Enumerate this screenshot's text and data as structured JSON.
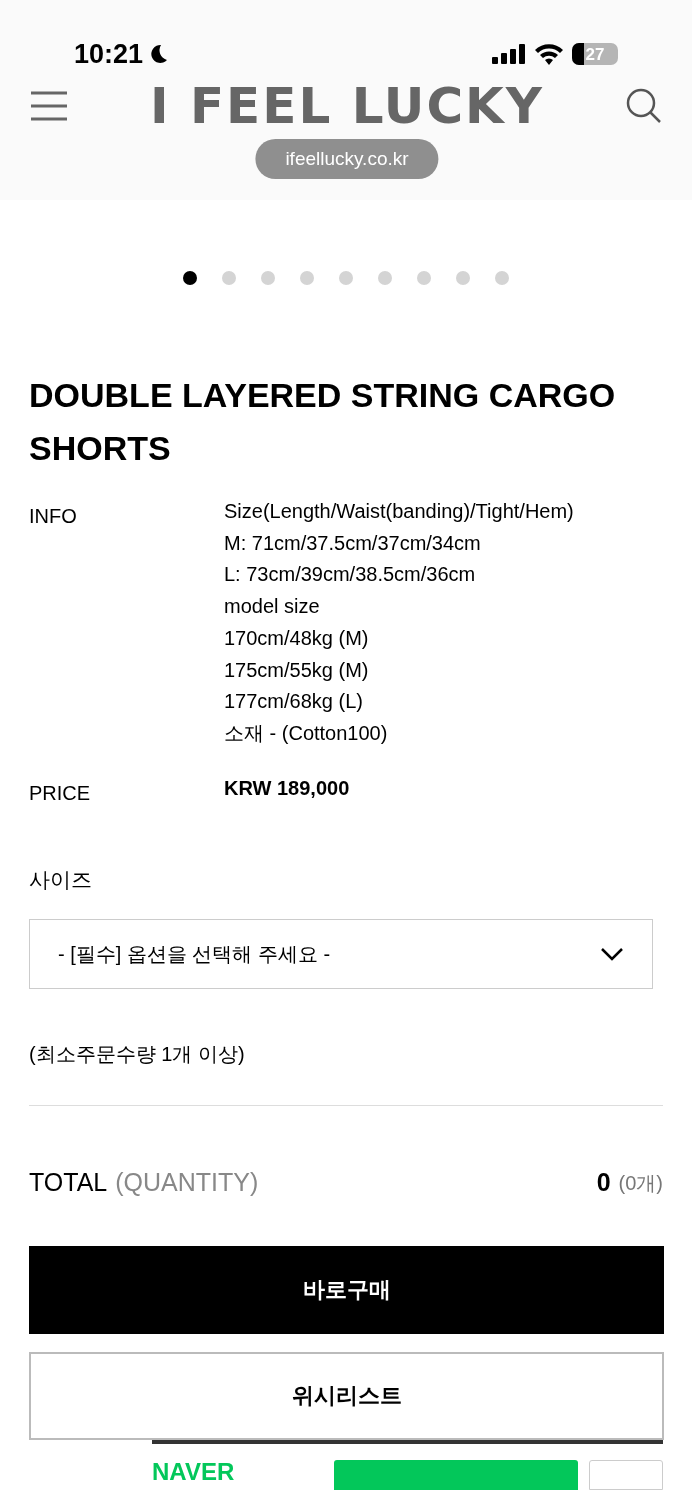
{
  "status_bar": {
    "time": "10:21",
    "battery": "27"
  },
  "header": {
    "logo": "I FEEL LUCKY",
    "url": "ifeellucky.co.kr"
  },
  "carousel_dots": [
    {
      "selected": true
    },
    {
      "selected": false
    },
    {
      "selected": false
    },
    {
      "selected": false
    },
    {
      "selected": false
    },
    {
      "selected": false
    },
    {
      "selected": false
    },
    {
      "selected": false
    },
    {
      "selected": false
    }
  ],
  "product": {
    "title": "DOUBLE LAYERED STRING CARGO SHORTS",
    "details": [
      {
        "label": "INFO",
        "lines": [
          "Size(Length/Waist(banding)/Tight/Hem)",
          "M: 71cm/37.5cm/37cm/34cm",
          "L: 73cm/39cm/38.5cm/36cm",
          "model size",
          "170cm/48kg (M)",
          "175cm/55kg (M)",
          "177cm/68kg (L)",
          "소재 - (Cotton100)"
        ],
        "bold": false
      },
      {
        "label": "PRICE",
        "lines": [
          "KRW 189,000"
        ],
        "bold": true
      }
    ]
  },
  "option": {
    "label": "사이즈",
    "select": "- [필수] 옵션을 선택해 주세요 -",
    "note": "(최소주문수량 1개 이상)"
  },
  "total": {
    "label": "TOTAL",
    "sub": "(QUANTITY)",
    "amount": "0",
    "count": "(0개)"
  },
  "buttons": [
    {
      "label": "바로구매",
      "kind": "primary"
    },
    {
      "label": "위시리스트",
      "kind": "secondary"
    }
  ],
  "naver": {
    "logo": "NAVER"
  }
}
